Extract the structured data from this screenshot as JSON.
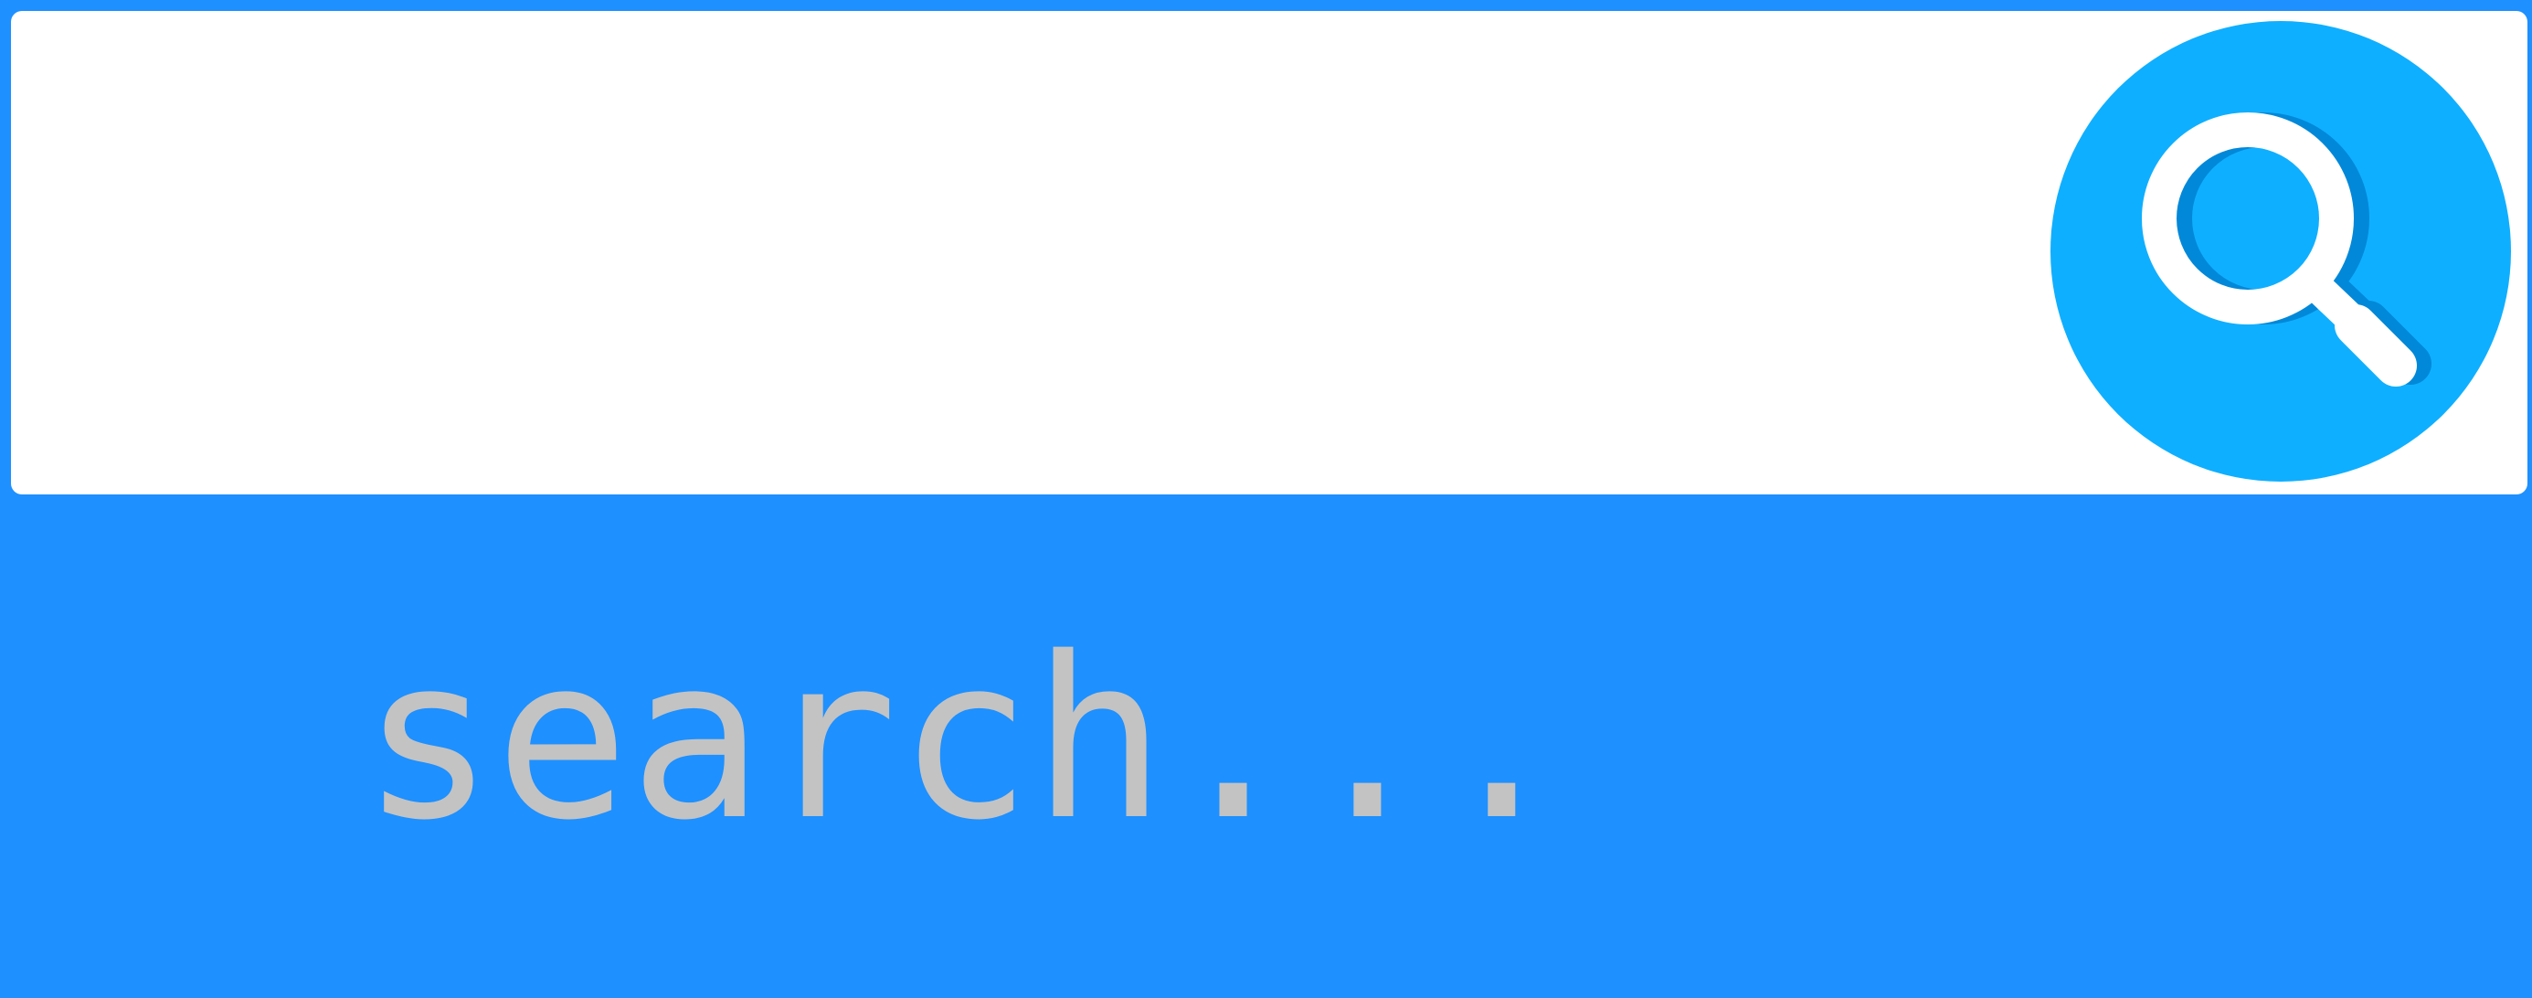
{
  "search": {
    "placeholder": "search...",
    "button_icon": "search-icon"
  },
  "colors": {
    "frame": "#1e90ff",
    "button": "#0fafff",
    "icon_shadow": "#0288d9",
    "placeholder_text": "#c3c3c3"
  }
}
